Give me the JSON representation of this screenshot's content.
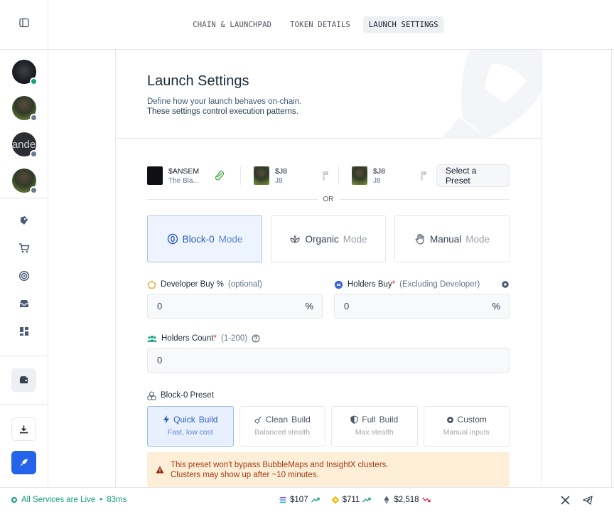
{
  "tabs": [
    {
      "label": "CHAIN & LAUNCHPAD"
    },
    {
      "label": "TOKEN DETAILS"
    },
    {
      "label": "LAUNCH SETTINGS"
    }
  ],
  "sidebar": {
    "avatars": [
      {
        "text": "",
        "status": "online"
      },
      {
        "text": "",
        "status": "offline"
      },
      {
        "text": "ande",
        "status": "offline"
      },
      {
        "text": "",
        "status": "offline"
      }
    ]
  },
  "header": {
    "title": "Launch Settings",
    "subtitle_line1": "Define how your launch behaves on-chain.",
    "subtitle_line2": "These settings control execution patterns."
  },
  "presets": [
    {
      "symbol": "$ANSEM",
      "name": "The Bla..."
    },
    {
      "symbol": "$J8",
      "name": "J8"
    },
    {
      "symbol": "$J8",
      "name": "J8"
    }
  ],
  "select_preset_label": "Select a Preset",
  "or_label": "OR",
  "modes": [
    {
      "name": "Block-0",
      "suffix": "Mode",
      "active": true
    },
    {
      "name": "Organic",
      "suffix": "Mode",
      "active": false
    },
    {
      "name": "Manual",
      "suffix": "Mode",
      "active": false
    }
  ],
  "developer_buy": {
    "label": "Developer Buy %",
    "optional": "(optional)",
    "value": "0",
    "suffix": "%"
  },
  "holders_buy": {
    "label": "Holders Buy",
    "required": "*",
    "note": "(Excluding Developer)",
    "value": "0",
    "suffix": "%"
  },
  "holders_count": {
    "label": "Holders Count",
    "required": "*",
    "range": "(1-200)",
    "value": "0"
  },
  "block_preset": {
    "label": "Block-0 Preset",
    "options": [
      {
        "word1": "Quick",
        "word2": "Build",
        "sub": "Fast, low cost",
        "active": true
      },
      {
        "word1": "Clean",
        "word2": "Build",
        "sub": "Balanced stealth",
        "active": false
      },
      {
        "word1": "Full",
        "word2": "Build",
        "sub": "Max stealth",
        "active": false
      },
      {
        "word1": "Custom",
        "word2": "",
        "sub": "Manual inputs",
        "active": false
      }
    ]
  },
  "warning": {
    "line1": "This preset won't bypass BubbleMaps and InsightX clusters.",
    "line2": "Clusters may show up after ~10 minutes."
  },
  "footer": {
    "status": "All Services are Live",
    "separator": "•",
    "latency": "83ms",
    "prices": [
      {
        "coin": "SOL",
        "value": "$107",
        "trend": "up"
      },
      {
        "coin": "BNB",
        "value": "$711",
        "trend": "up"
      },
      {
        "coin": "ETH",
        "value": "$2,518",
        "trend": "down"
      }
    ]
  },
  "colors": {
    "accent": "#2563eb",
    "live": "#0f9d7a",
    "warning_bg": "#fdeed7",
    "warning_text": "#a63a12"
  }
}
